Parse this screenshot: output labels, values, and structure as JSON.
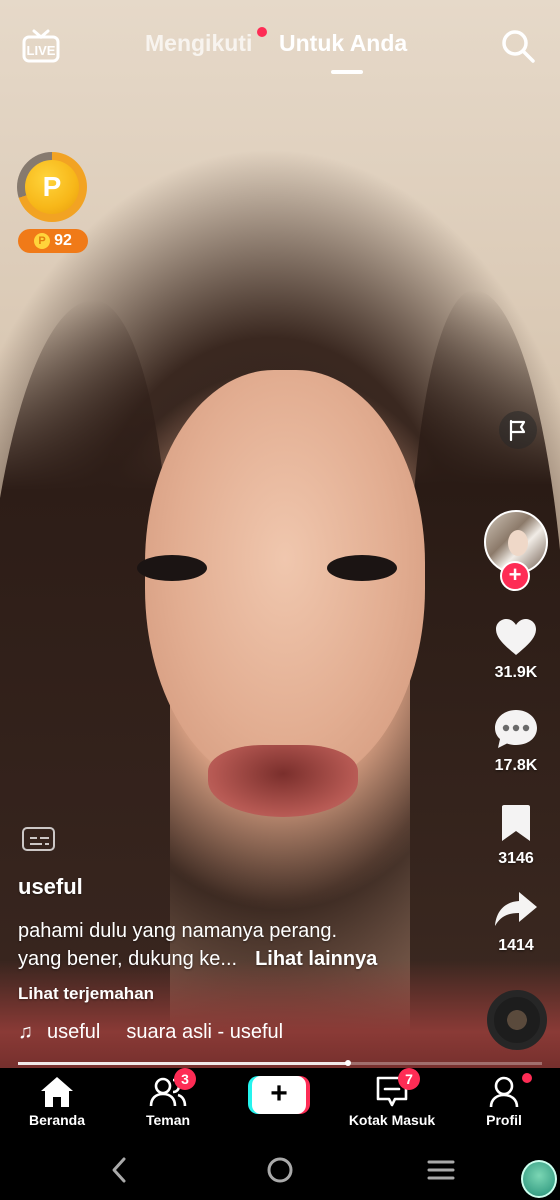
{
  "top_bar": {
    "live_label": "LIVE",
    "tab_following": "Mengikuti",
    "tab_for_you": "Untuk Anda"
  },
  "points": {
    "coin_letter": "P",
    "badge_letter": "P",
    "value": "92",
    "ring_progress": 0.7
  },
  "actions": {
    "likes": "31.9K",
    "comments": "17.8K",
    "bookmarks": "3146",
    "shares": "1414"
  },
  "post": {
    "username": "useful",
    "caption_line1": "pahami dulu yang namanya perang.",
    "caption_line2": "yang bener, dukung ke...",
    "see_more": "Lihat lainnya",
    "translate": "Lihat terjemahan",
    "music_artist": "useful",
    "music_title": "suara asli - useful"
  },
  "playback": {
    "progress": 0.63
  },
  "bottom_nav": {
    "home": "Beranda",
    "friends": "Teman",
    "friends_badge": "3",
    "create": "+",
    "inbox": "Kotak Masuk",
    "inbox_badge": "7",
    "profile": "Profil"
  },
  "colors": {
    "accent_red": "#fe2c55",
    "accent_cyan": "#25f4ee",
    "points_orange": "#f07a18"
  },
  "icons": {
    "live": "live-tv-icon",
    "search": "search-icon",
    "report": "flag-icon",
    "like": "heart-icon",
    "comment": "speech-bubble-icon",
    "bookmark": "bookmark-icon",
    "share": "share-arrow-icon",
    "captions": "captions-icon",
    "music": "music-note-icon"
  }
}
